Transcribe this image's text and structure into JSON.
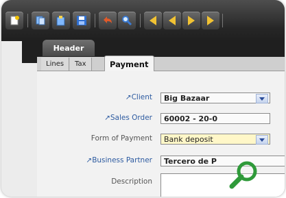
{
  "header_tab": "Header",
  "subtabs": [
    "Lines",
    "Tax",
    "Payment"
  ],
  "form": {
    "client_label": "Client",
    "client_value": "Big Bazaar",
    "sales_order_label": "Sales Order",
    "sales_order_value": "60002 - 20-0",
    "form_of_payment_label": "Form of Payment",
    "form_of_payment_value": "Bank deposit",
    "business_partner_label": "Business Partner",
    "business_partner_value": "Tercero de P",
    "description_label": "Description"
  },
  "icons": [
    "new-document-icon",
    "copy-icon",
    "paste-icon",
    "save-icon",
    "undo-icon",
    "find-icon",
    "first-record-icon",
    "previous-record-icon",
    "next-record-icon",
    "last-record-icon",
    "zoom-icon"
  ],
  "colors": {
    "toolbar": "#2e2e2e",
    "link": "#2c5aa0",
    "highlight_field": "#fff7c8",
    "accent_green": "#2f9a3a"
  }
}
